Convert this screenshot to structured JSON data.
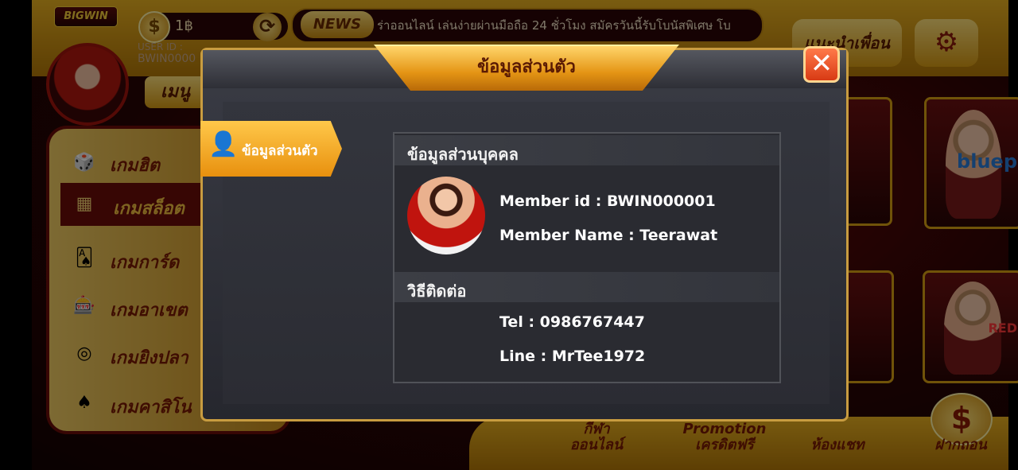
{
  "app": {
    "logo_text": "BIGWIN"
  },
  "topbar": {
    "coin_symbol": "$",
    "balance": "1฿",
    "refresh_icon": "refresh-icon",
    "user_id_label": "USER ID :",
    "user_id_value": "BWIN0000",
    "news_tag": "NEWS",
    "news_text": "ร่าออนไลน์ เล่นง่ายผ่านมือถือ 24 ชั่วโมง สมัครวันนี้รับโบนัสพิเศษ โบ",
    "invite_label": "แนะนำเพื่อน",
    "settings_icon": "gear-icon",
    "menu_label": "เมนู"
  },
  "left_menu": {
    "items": [
      {
        "label": "เกมฮิต",
        "icon": "dice-icon"
      },
      {
        "label": "เกมสล็อต",
        "icon": "slot-icon"
      },
      {
        "label": "เกมการ์ด",
        "icon": "cards-icon"
      },
      {
        "label": "เกมอาเขต",
        "icon": "arcade-icon"
      },
      {
        "label": "เกมยิงปลา",
        "icon": "fishing-icon"
      },
      {
        "label": "เกมคาสิโน",
        "icon": "casino-icon"
      }
    ]
  },
  "right_cards": {
    "brand_blue": "bluep",
    "brand_red": "RED"
  },
  "bottombar": {
    "items": [
      {
        "label": "กีฬา\nออนไลน์"
      },
      {
        "label": "Promotion\nเครดิตฟรี"
      },
      {
        "label": "ห้องแชท"
      },
      {
        "label": "ฝากถอน"
      }
    ],
    "dollar_symbol": "$"
  },
  "modal": {
    "title": "ข้อมูลส่วนตัว",
    "close_symbol": "✕",
    "side_tab_label": "ข้อมูลส่วนตัว",
    "personal_section_title": "ข้อมูลส่วนบุคคล",
    "member_id_line": "Member id : BWIN000001",
    "member_name_line": "Member Name : Teerawat",
    "contact_section_title": "วิธีติดต่อ",
    "tel_line": "Tel : 0986767447",
    "line_line": "Line : MrTee1972"
  },
  "colors": {
    "gold": "#e8b020",
    "dark_red": "#6a0c08",
    "modal_bg": "#2b2c33",
    "title_orange": "#e49414"
  }
}
